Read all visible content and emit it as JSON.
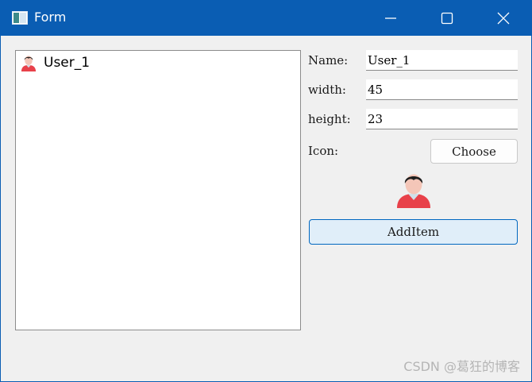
{
  "window": {
    "title": "Form"
  },
  "list": {
    "items": [
      {
        "label": "User_1",
        "icon": "user-avatar-icon"
      }
    ]
  },
  "form": {
    "name_label": "Name:",
    "name_value": "User_1",
    "width_label": "width:",
    "width_value": "45",
    "height_label": "height:",
    "height_value": "23",
    "icon_label": "Icon:",
    "choose_label": "Choose",
    "add_label": "AddItem"
  },
  "watermark": "CSDN @葛狂的博客",
  "colors": {
    "titlebar": "#0a5db3",
    "accent_border": "#0067c0",
    "add_button_bg": "#e0eef9",
    "avatar_shirt": "#e8414a",
    "avatar_face": "#f4c6b8"
  }
}
